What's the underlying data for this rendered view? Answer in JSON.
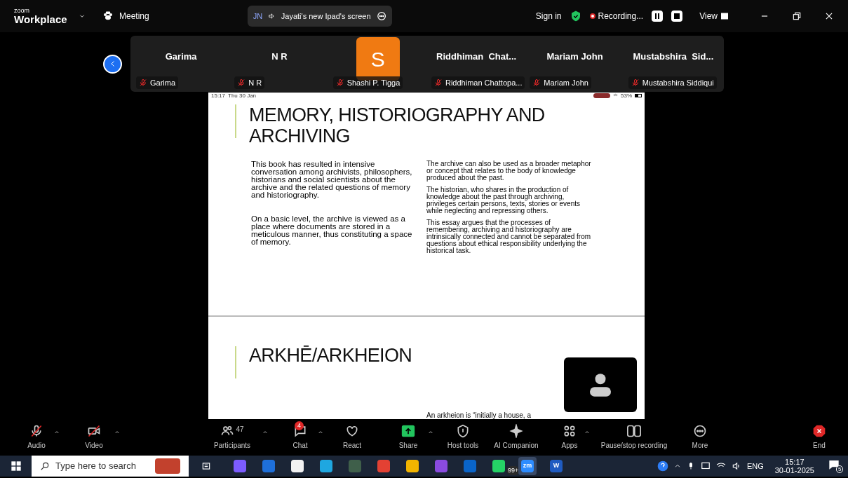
{
  "top_bar": {
    "brand_small": "zoom",
    "brand": "Workplace",
    "meeting_label": "Meeting",
    "share_pill": {
      "initials": "JN",
      "label": "Jayati's new Ipad's screen"
    },
    "sign_in": "Sign in",
    "recording": "Recording...",
    "view": "View"
  },
  "participants": [
    {
      "kind": "name",
      "name": "Garima",
      "label": "Garima",
      "muted": true
    },
    {
      "kind": "name",
      "name": "N R",
      "label": "N R",
      "muted": true
    },
    {
      "kind": "avatar",
      "letter": "S",
      "label": "Shashi P. Tigga",
      "muted": true
    },
    {
      "kind": "name",
      "name": "Riddhiman  Chat...",
      "label": "Riddhiman Chattopa...",
      "muted": true
    },
    {
      "kind": "name",
      "name": "Mariam John",
      "label": "Mariam John",
      "muted": true
    },
    {
      "kind": "name",
      "name": "Mustabshira  Sid...",
      "label": "Mustabshira Siddiqui",
      "muted": true
    }
  ],
  "shared_screen": {
    "status_time": "15:17",
    "status_date": "Thu 30 Jan",
    "battery": "53%",
    "slides": [
      {
        "title": "MEMORY, HISTORIOGRAPHY AND ARCHIVING",
        "left": [
          "This book has resulted in intensive conversation among archivists, philosophers, historians and social scientists about the archive and the related questions of memory and historiography.",
          "On a basic level, the archive is viewed as a place where documents are stored in a meticulous manner, thus constituting a space of memory."
        ],
        "right": [
          "The archive can also be used as a broader metaphor or concept that relates to the body of knowledge produced about the past.",
          "The historian, who shares in the production of knowledge about the past through archiving, privileges certain persons, texts, stories or events while neglecting and repressing others.",
          "This essay argues that the processes of remembering, archiving and historiography are intrinsically connected and cannot be separated from questions about ethical responsibility underlying the historical task."
        ]
      },
      {
        "title": "ARKHĒ/ARKHEION",
        "right": [
          "An arkheion is “initially a house, a"
        ]
      }
    ]
  },
  "toolbar": [
    {
      "kind": "audio",
      "label": "Audio",
      "muted": true,
      "caret": true
    },
    {
      "kind": "video",
      "label": "Video",
      "muted": true,
      "caret": true
    },
    {
      "kind": "participants",
      "label": "Participants",
      "count": "47",
      "caret": true
    },
    {
      "kind": "chat",
      "label": "Chat",
      "badge": "4",
      "caret": true
    },
    {
      "kind": "react",
      "label": "React"
    },
    {
      "kind": "share",
      "label": "Share",
      "caret": true
    },
    {
      "kind": "host",
      "label": "Host tools"
    },
    {
      "kind": "ai",
      "label": "AI Companion"
    },
    {
      "kind": "apps",
      "label": "Apps",
      "caret": true
    },
    {
      "kind": "record",
      "label": "Pause/stop recording"
    },
    {
      "kind": "more",
      "label": "More"
    },
    {
      "kind": "end",
      "label": "End"
    }
  ],
  "taskbar": {
    "search_placeholder": "Type here to search",
    "apps": [
      {
        "color": "#7c5cff"
      },
      {
        "color": "#1e6fd9"
      },
      {
        "color": "#f2f2f2"
      },
      {
        "color": "#1fa7e0"
      },
      {
        "color": "#3f5f4a"
      },
      {
        "color": "#e34133"
      },
      {
        "color": "#f2b400"
      },
      {
        "color": "#8a4be0"
      },
      {
        "color": "#0a64c8"
      },
      {
        "color": "#25d366",
        "badge": "99+"
      },
      {
        "color": "#2d8cff",
        "text": "zm",
        "selected": true
      },
      {
        "color": "#1f5bc1",
        "text": "W"
      }
    ],
    "language": "ENG",
    "time": "15:17",
    "date": "30-01-2025",
    "notifications": "5"
  }
}
